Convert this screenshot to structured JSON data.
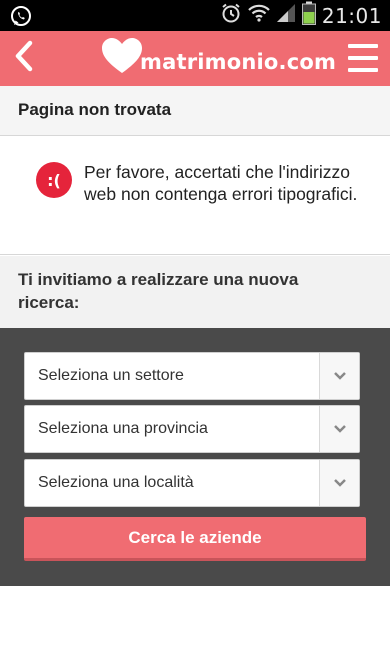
{
  "statusbar": {
    "time": "21:01",
    "icons": [
      "whatsapp-icon",
      "alarm-icon",
      "wifi-icon",
      "signal-icon",
      "battery-icon"
    ]
  },
  "header": {
    "logo_text": "matrimonio.com",
    "back_icon": "chevron-left-icon",
    "menu_icon": "hamburger-menu-icon",
    "brand_color": "#f06c72"
  },
  "page": {
    "title": "Pagina non trovata",
    "error_icon_text": ":(",
    "error_message": "Per favore, accertati che l'indirizzo web non contenga errori tipografici.",
    "error_color": "#e5243b"
  },
  "search": {
    "heading": "Ti invitiamo a realizzare una nuova ricerca:",
    "select_sector": "Seleziona un settore",
    "select_province": "Seleziona una provincia",
    "select_locality": "Seleziona una località",
    "submit_label": "Cerca le aziende",
    "panel_color": "#4a4a4a"
  }
}
